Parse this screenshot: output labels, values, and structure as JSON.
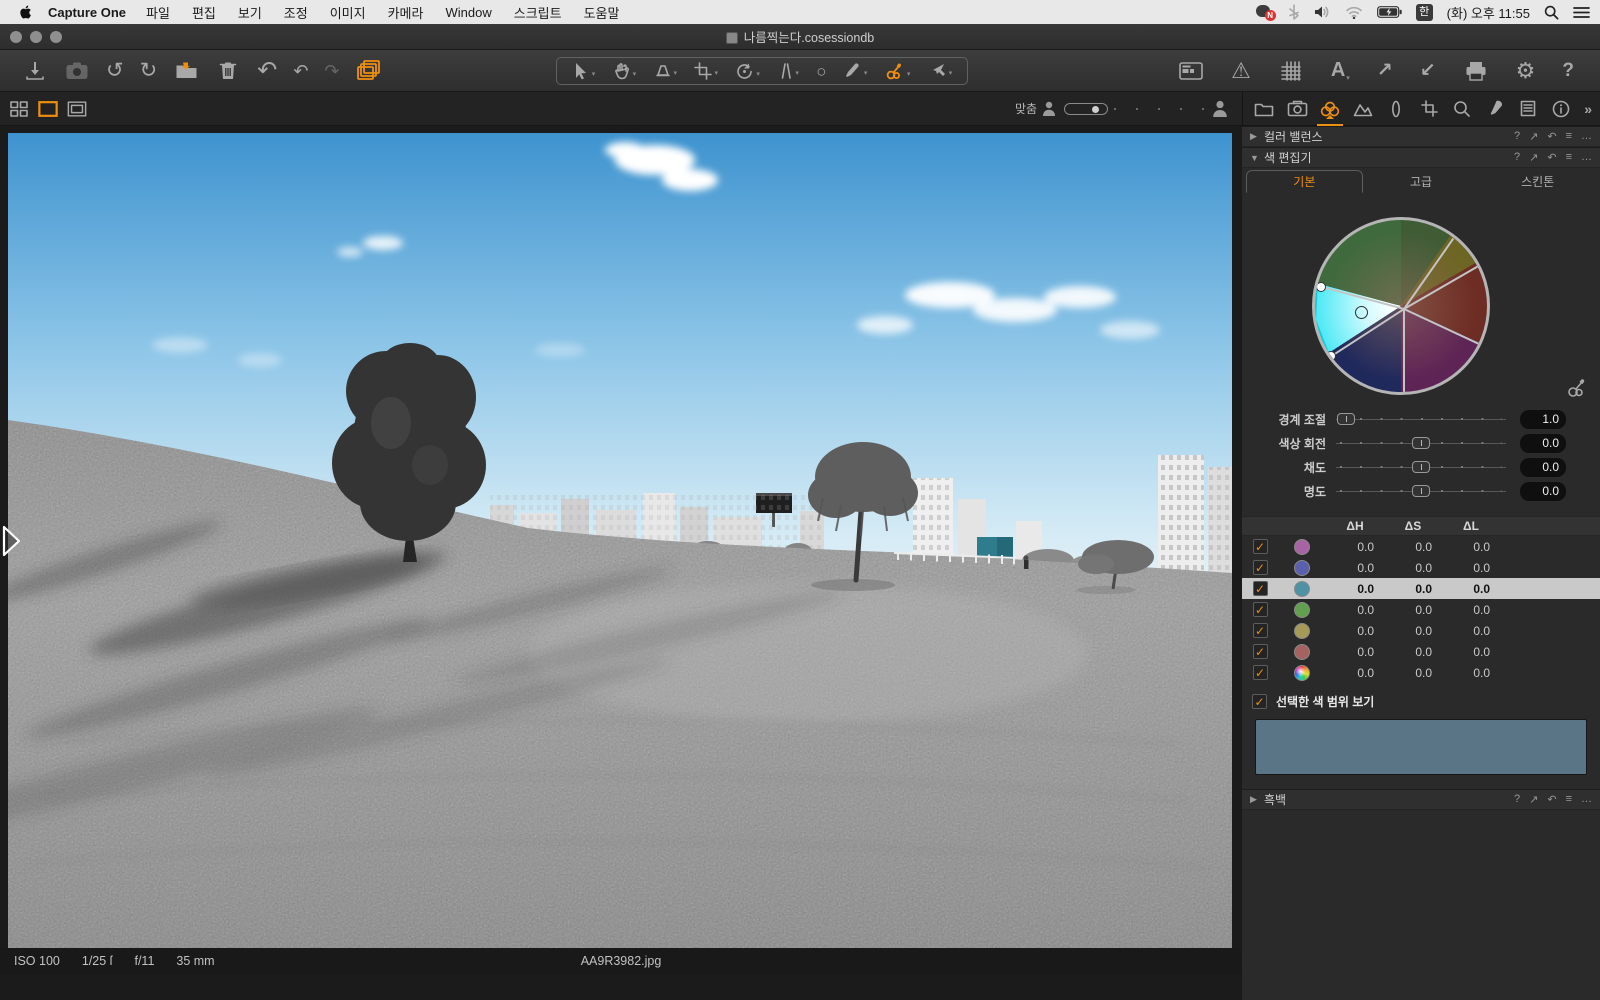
{
  "menubar": {
    "app_name": "Capture One",
    "menus": [
      "파일",
      "편집",
      "보기",
      "조정",
      "이미지",
      "카메라",
      "Window",
      "스크립트",
      "도움말"
    ],
    "kakao_badge": "N",
    "input_badge": "한",
    "clock": "(화) 오후 11:55"
  },
  "window_title": "나름찍는다.cosessiondb",
  "viewer": {
    "fit_label": "맞춤",
    "status": {
      "iso": "ISO 100",
      "shutter": "1/25 ſ",
      "aperture": "f/11",
      "focal_length": "35 mm",
      "filename": "AA9R3982.jpg"
    }
  },
  "panels": {
    "color_balance": {
      "title": "컬러 밸런스"
    },
    "color_editor": {
      "title": "색 편집기",
      "tabs": [
        "기본",
        "고급",
        "스킨톤"
      ],
      "active_tab": 0,
      "sliders": [
        {
          "label": "경계 조절",
          "value": "1.0",
          "pos": 6
        },
        {
          "label": "색상 회전",
          "value": "0.0",
          "pos": 50
        },
        {
          "label": "채도",
          "value": "0.0",
          "pos": 50
        },
        {
          "label": "명도",
          "value": "0.0",
          "pos": 50
        }
      ],
      "table": {
        "columns": [
          "ΔH",
          "ΔS",
          "ΔL"
        ],
        "rows": [
          {
            "color": "#a763a3",
            "h": "0.0",
            "s": "0.0",
            "l": "0.0",
            "checked": true,
            "selected": false
          },
          {
            "color": "#5b60ac",
            "h": "0.0",
            "s": "0.0",
            "l": "0.0",
            "checked": true,
            "selected": false
          },
          {
            "color": "#4e92a4",
            "h": "0.0",
            "s": "0.0",
            "l": "0.0",
            "checked": true,
            "selected": true
          },
          {
            "color": "#61a04e",
            "h": "0.0",
            "s": "0.0",
            "l": "0.0",
            "checked": true,
            "selected": false
          },
          {
            "color": "#a79a56",
            "h": "0.0",
            "s": "0.0",
            "l": "0.0",
            "checked": true,
            "selected": false
          },
          {
            "color": "#a4635e",
            "h": "0.0",
            "s": "0.0",
            "l": "0.0",
            "checked": true,
            "selected": false
          },
          {
            "color": "rainbow",
            "h": "0.0",
            "s": "0.0",
            "l": "0.0",
            "checked": true,
            "selected": false
          }
        ]
      },
      "show_range_label": "선택한 색 범위 보기",
      "show_range_checked": true,
      "preview_color": "#5a7585"
    },
    "bw": {
      "title": "흑백"
    }
  },
  "icons": {
    "check": "✓",
    "tri_right": "▶",
    "tri_down": "▼",
    "help": "?",
    "sync": "↗",
    "reset": "↶",
    "menu": "≡",
    "more": "…",
    "chevrons": "»",
    "caret": "▾",
    "circle_tool": "○",
    "rotate_ccw": "↺",
    "rotate_cw": "↻",
    "undo_big": "↶",
    "undo": "↶",
    "redo": "↷",
    "warning": "⚠",
    "gear": "⚙",
    "arrow_out": "↗",
    "arrow_in": "↙",
    "letter_a": "A",
    "question": "?"
  }
}
